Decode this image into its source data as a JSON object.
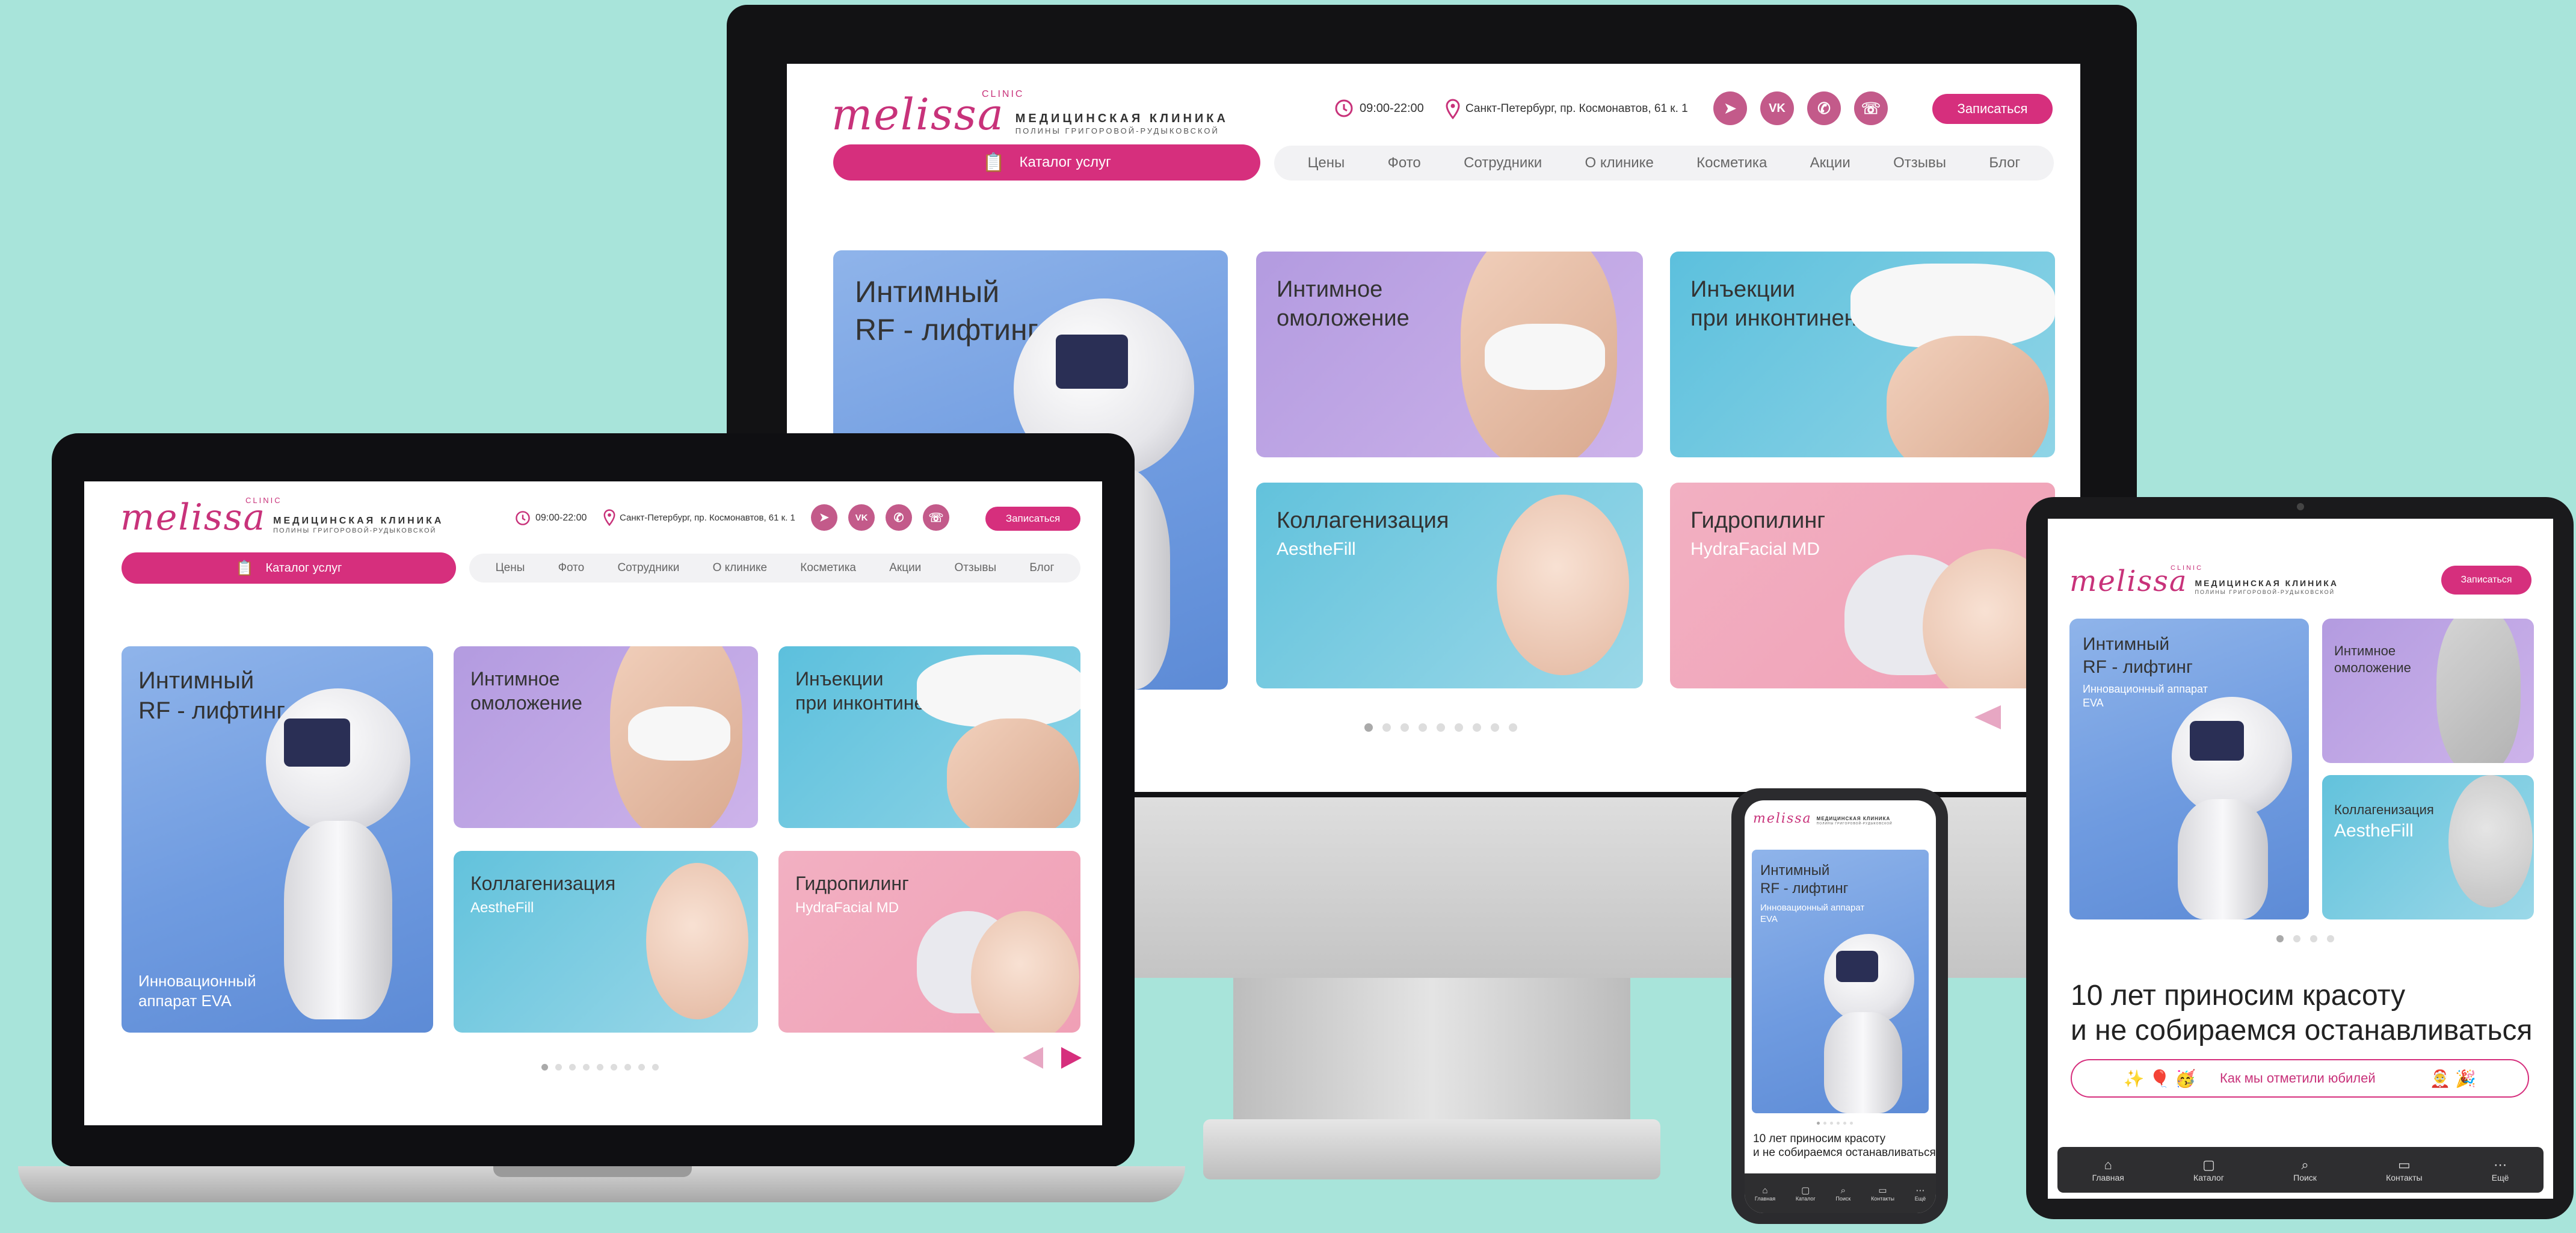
{
  "brand": {
    "logo": "melissa",
    "clinic_tag": "CLINIC",
    "title_line1": "МЕДИЦИНСКАЯ КЛИНИКА",
    "title_line2": "ПОЛИНЫ ГРИГОРОВОЙ-РУДЫКОВСКОЙ"
  },
  "header": {
    "hours": "09:00-22:00",
    "address": "Санкт-Петербург, пр. Космонавтов, 61 к. 1",
    "book_button": "Записаться",
    "social": [
      {
        "icon": "telegram-icon",
        "glyph": "➤"
      },
      {
        "icon": "vk-icon",
        "glyph": "VK"
      },
      {
        "icon": "whatsapp-icon",
        "glyph": "✆"
      },
      {
        "icon": "viber-icon",
        "glyph": "☏"
      }
    ]
  },
  "catalog_button": "Каталог услуг",
  "nav": [
    "Цены",
    "Фото",
    "Сотрудники",
    "О клинике",
    "Косметика",
    "Акции",
    "Отзывы",
    "Блог"
  ],
  "cards": {
    "rf": {
      "title1": "Интимный",
      "title2": "RF - лифтинг",
      "sub1": "Инновационный",
      "sub2": "аппарат EVA",
      "tablet_sub1": "Инновационный аппарат",
      "tablet_sub2": "EVA"
    },
    "rejuv": {
      "title1": "Интимное",
      "title2": "омоложение"
    },
    "inj": {
      "title1": "Инъекции",
      "title2": "при инконтиненции"
    },
    "collagen": {
      "title": "Коллагенизация",
      "sub": "AestheFill"
    },
    "hydro": {
      "title": "Гидропилинг",
      "sub": "HydraFacial MD"
    }
  },
  "slider": {
    "dots_desktop": 9,
    "active": 0
  },
  "promo": {
    "line1": "10 лет приносим красоту",
    "line2": "и не собираемся останавливаться",
    "jubilee_link": "Как мы отметили юбилей",
    "emojis_left": "✨ 🎈 🥳",
    "emojis_right": "🤶 🎉"
  },
  "bottom_nav": [
    {
      "label": "Главная",
      "icon": "home-icon",
      "glyph": "⌂"
    },
    {
      "label": "Каталог",
      "icon": "bag-icon",
      "glyph": "▢"
    },
    {
      "label": "Поиск",
      "icon": "search-icon",
      "glyph": "⌕"
    },
    {
      "label": "Контакты",
      "icon": "chat-icon",
      "glyph": "▭"
    },
    {
      "label": "Ещё",
      "icon": "more-icon",
      "glyph": "⋯"
    }
  ],
  "colors": {
    "accent": "#d62f7d",
    "background": "#a8e4da"
  }
}
